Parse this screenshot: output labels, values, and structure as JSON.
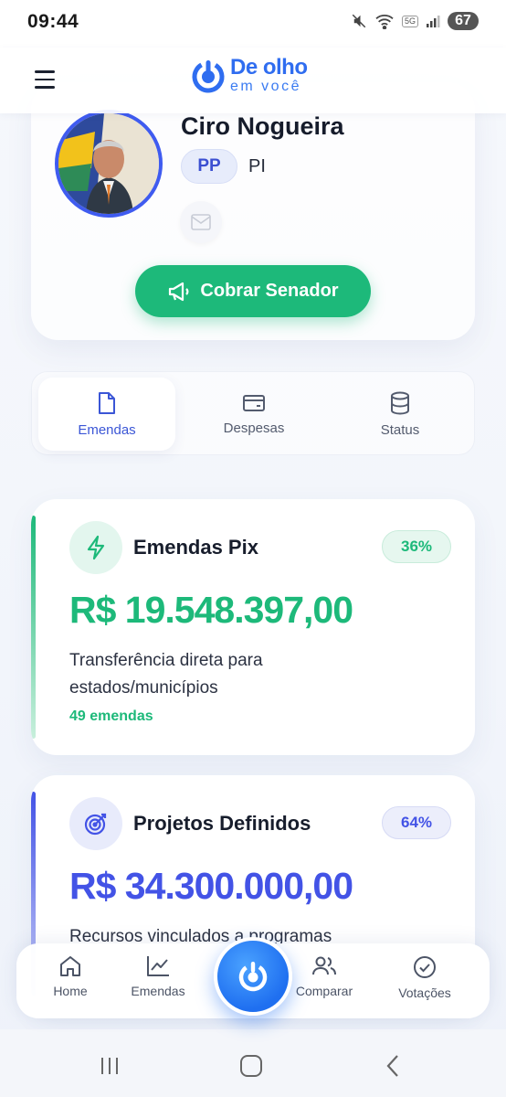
{
  "status_bar": {
    "time": "09:44",
    "network": "5G",
    "battery": "67"
  },
  "app": {
    "logo_title": "De olho",
    "logo_subtitle": "em você"
  },
  "profile": {
    "name": "Ciro Nogueira",
    "party": "PP",
    "state": "PI",
    "cta_label": "Cobrar Senador"
  },
  "tabs": [
    {
      "label": "Emendas",
      "icon": "document-icon",
      "active": true
    },
    {
      "label": "Despesas",
      "icon": "wallet-icon",
      "active": false
    },
    {
      "label": "Status",
      "icon": "database-icon",
      "active": false
    }
  ],
  "cards": [
    {
      "title": "Emendas Pix",
      "percent": "36%",
      "amount": "R$ 19.548.397,00",
      "description": "Transferência direta para estados/municípios",
      "count": "49 emendas",
      "icon": "lightning-icon",
      "color": "#1db97a"
    },
    {
      "title": "Projetos Definidos",
      "percent": "64%",
      "amount": "R$ 34.300.000,00",
      "description": "Recursos vinculados a programas",
      "icon": "target-icon",
      "color": "#4353e6"
    }
  ],
  "bottom_nav": [
    {
      "label": "Home",
      "icon": "home-icon"
    },
    {
      "label": "Emendas",
      "icon": "chart-line-icon"
    },
    {
      "label": "Comparar",
      "icon": "users-icon"
    },
    {
      "label": "Votações",
      "icon": "check-circle-icon"
    }
  ],
  "colors": {
    "primary": "#2f6df0",
    "green": "#1db97a",
    "indigo": "#4353e6"
  }
}
